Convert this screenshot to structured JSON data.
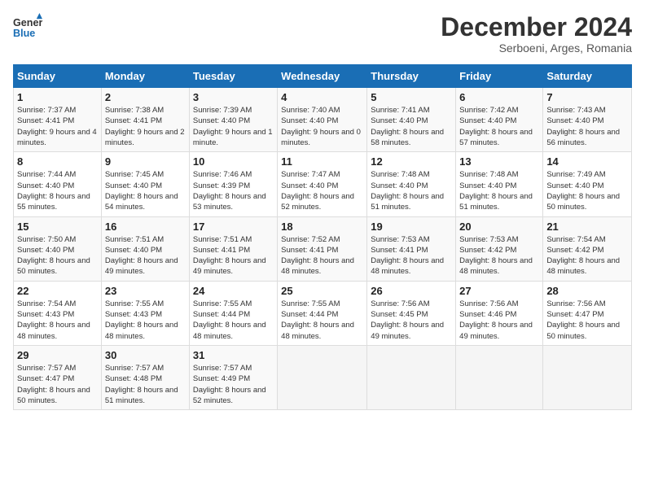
{
  "logo": {
    "line1": "General",
    "line2": "Blue"
  },
  "title": "December 2024",
  "subtitle": "Serboeni, Arges, Romania",
  "days_header": [
    "Sunday",
    "Monday",
    "Tuesday",
    "Wednesday",
    "Thursday",
    "Friday",
    "Saturday"
  ],
  "weeks": [
    [
      {
        "day": "1",
        "rise": "Sunrise: 7:37 AM",
        "set": "Sunset: 4:41 PM",
        "light": "Daylight: 9 hours and 4 minutes."
      },
      {
        "day": "2",
        "rise": "Sunrise: 7:38 AM",
        "set": "Sunset: 4:41 PM",
        "light": "Daylight: 9 hours and 2 minutes."
      },
      {
        "day": "3",
        "rise": "Sunrise: 7:39 AM",
        "set": "Sunset: 4:40 PM",
        "light": "Daylight: 9 hours and 1 minute."
      },
      {
        "day": "4",
        "rise": "Sunrise: 7:40 AM",
        "set": "Sunset: 4:40 PM",
        "light": "Daylight: 9 hours and 0 minutes."
      },
      {
        "day": "5",
        "rise": "Sunrise: 7:41 AM",
        "set": "Sunset: 4:40 PM",
        "light": "Daylight: 8 hours and 58 minutes."
      },
      {
        "day": "6",
        "rise": "Sunrise: 7:42 AM",
        "set": "Sunset: 4:40 PM",
        "light": "Daylight: 8 hours and 57 minutes."
      },
      {
        "day": "7",
        "rise": "Sunrise: 7:43 AM",
        "set": "Sunset: 4:40 PM",
        "light": "Daylight: 8 hours and 56 minutes."
      }
    ],
    [
      {
        "day": "8",
        "rise": "Sunrise: 7:44 AM",
        "set": "Sunset: 4:40 PM",
        "light": "Daylight: 8 hours and 55 minutes."
      },
      {
        "day": "9",
        "rise": "Sunrise: 7:45 AM",
        "set": "Sunset: 4:40 PM",
        "light": "Daylight: 8 hours and 54 minutes."
      },
      {
        "day": "10",
        "rise": "Sunrise: 7:46 AM",
        "set": "Sunset: 4:39 PM",
        "light": "Daylight: 8 hours and 53 minutes."
      },
      {
        "day": "11",
        "rise": "Sunrise: 7:47 AM",
        "set": "Sunset: 4:40 PM",
        "light": "Daylight: 8 hours and 52 minutes."
      },
      {
        "day": "12",
        "rise": "Sunrise: 7:48 AM",
        "set": "Sunset: 4:40 PM",
        "light": "Daylight: 8 hours and 51 minutes."
      },
      {
        "day": "13",
        "rise": "Sunrise: 7:48 AM",
        "set": "Sunset: 4:40 PM",
        "light": "Daylight: 8 hours and 51 minutes."
      },
      {
        "day": "14",
        "rise": "Sunrise: 7:49 AM",
        "set": "Sunset: 4:40 PM",
        "light": "Daylight: 8 hours and 50 minutes."
      }
    ],
    [
      {
        "day": "15",
        "rise": "Sunrise: 7:50 AM",
        "set": "Sunset: 4:40 PM",
        "light": "Daylight: 8 hours and 50 minutes."
      },
      {
        "day": "16",
        "rise": "Sunrise: 7:51 AM",
        "set": "Sunset: 4:40 PM",
        "light": "Daylight: 8 hours and 49 minutes."
      },
      {
        "day": "17",
        "rise": "Sunrise: 7:51 AM",
        "set": "Sunset: 4:41 PM",
        "light": "Daylight: 8 hours and 49 minutes."
      },
      {
        "day": "18",
        "rise": "Sunrise: 7:52 AM",
        "set": "Sunset: 4:41 PM",
        "light": "Daylight: 8 hours and 48 minutes."
      },
      {
        "day": "19",
        "rise": "Sunrise: 7:53 AM",
        "set": "Sunset: 4:41 PM",
        "light": "Daylight: 8 hours and 48 minutes."
      },
      {
        "day": "20",
        "rise": "Sunrise: 7:53 AM",
        "set": "Sunset: 4:42 PM",
        "light": "Daylight: 8 hours and 48 minutes."
      },
      {
        "day": "21",
        "rise": "Sunrise: 7:54 AM",
        "set": "Sunset: 4:42 PM",
        "light": "Daylight: 8 hours and 48 minutes."
      }
    ],
    [
      {
        "day": "22",
        "rise": "Sunrise: 7:54 AM",
        "set": "Sunset: 4:43 PM",
        "light": "Daylight: 8 hours and 48 minutes."
      },
      {
        "day": "23",
        "rise": "Sunrise: 7:55 AM",
        "set": "Sunset: 4:43 PM",
        "light": "Daylight: 8 hours and 48 minutes."
      },
      {
        "day": "24",
        "rise": "Sunrise: 7:55 AM",
        "set": "Sunset: 4:44 PM",
        "light": "Daylight: 8 hours and 48 minutes."
      },
      {
        "day": "25",
        "rise": "Sunrise: 7:55 AM",
        "set": "Sunset: 4:44 PM",
        "light": "Daylight: 8 hours and 48 minutes."
      },
      {
        "day": "26",
        "rise": "Sunrise: 7:56 AM",
        "set": "Sunset: 4:45 PM",
        "light": "Daylight: 8 hours and 49 minutes."
      },
      {
        "day": "27",
        "rise": "Sunrise: 7:56 AM",
        "set": "Sunset: 4:46 PM",
        "light": "Daylight: 8 hours and 49 minutes."
      },
      {
        "day": "28",
        "rise": "Sunrise: 7:56 AM",
        "set": "Sunset: 4:47 PM",
        "light": "Daylight: 8 hours and 50 minutes."
      }
    ],
    [
      {
        "day": "29",
        "rise": "Sunrise: 7:57 AM",
        "set": "Sunset: 4:47 PM",
        "light": "Daylight: 8 hours and 50 minutes."
      },
      {
        "day": "30",
        "rise": "Sunrise: 7:57 AM",
        "set": "Sunset: 4:48 PM",
        "light": "Daylight: 8 hours and 51 minutes."
      },
      {
        "day": "31",
        "rise": "Sunrise: 7:57 AM",
        "set": "Sunset: 4:49 PM",
        "light": "Daylight: 8 hours and 52 minutes."
      },
      null,
      null,
      null,
      null
    ]
  ]
}
